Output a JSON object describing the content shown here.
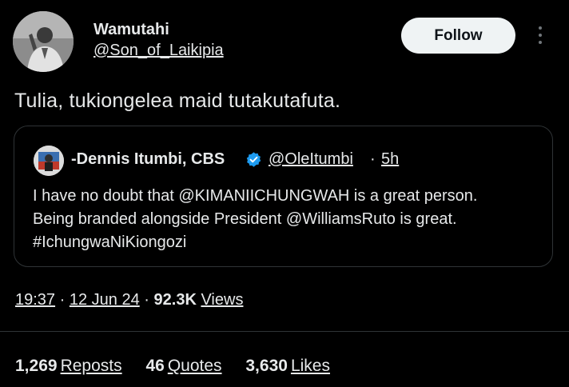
{
  "author": {
    "display_name": "Wamutahi",
    "handle": "@Son_of_Laikipia"
  },
  "follow_label": "Follow",
  "tweet_text": "Tulia, tukiongelea maid tutakutafuta.",
  "quoted": {
    "display_name": "-Dennis Itumbi, CBS",
    "handle": "@OleItumbi",
    "separator": "·",
    "time": "5h",
    "lines": [
      "I have no doubt that @KIMANIICHUNGWAH is a great person.",
      "Being branded alongside President @WilliamsRuto is great.",
      "#IchungwaNiKiongozi"
    ]
  },
  "meta": {
    "time": "19:37",
    "sep": "·",
    "date": "12 Jun 24",
    "views_count": "92.3K",
    "views_label": "Views"
  },
  "stats": {
    "reposts_count": "1,269",
    "reposts_label": "Reposts",
    "quotes_count": "46",
    "quotes_label": "Quotes",
    "likes_count": "3,630",
    "likes_label": "Likes"
  },
  "colors": {
    "background": "#000000",
    "text": "#e7e9ea",
    "border": "#2f3336",
    "follow_bg": "#eff3f4",
    "verified": "#1d9bf0"
  }
}
